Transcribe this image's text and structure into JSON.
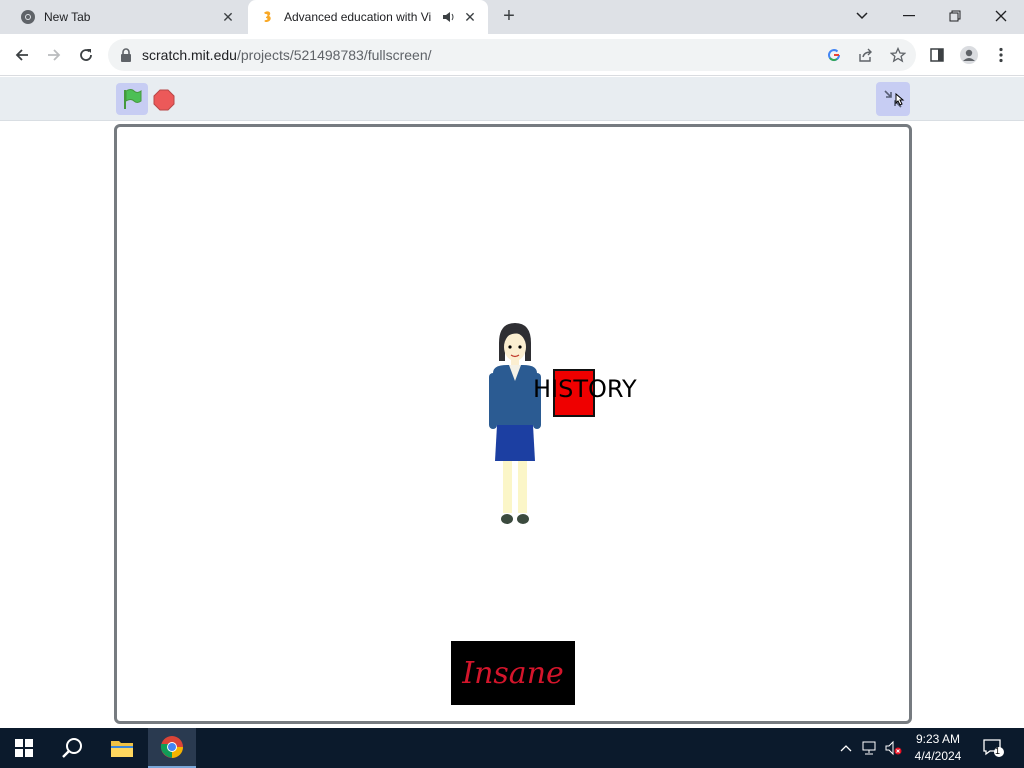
{
  "browser": {
    "tabs": [
      {
        "title": "New Tab",
        "active": false
      },
      {
        "title": "Advanced education with Vi",
        "active": true
      }
    ],
    "url_host": "scratch.mit.edu",
    "url_path": "/projects/521498783/fullscreen/"
  },
  "stage": {
    "history_label": "HISTORY",
    "difficulty_button": "Insane"
  },
  "taskbar": {
    "time": "9:23 AM",
    "date": "4/4/2024",
    "notification_count": "1"
  },
  "colors": {
    "flag_green": "#4cbf56",
    "stop_red": "#ec5959",
    "history_box": "#ef0000",
    "insane_text": "#d4152b",
    "taskbar": "#0b1a2c"
  }
}
